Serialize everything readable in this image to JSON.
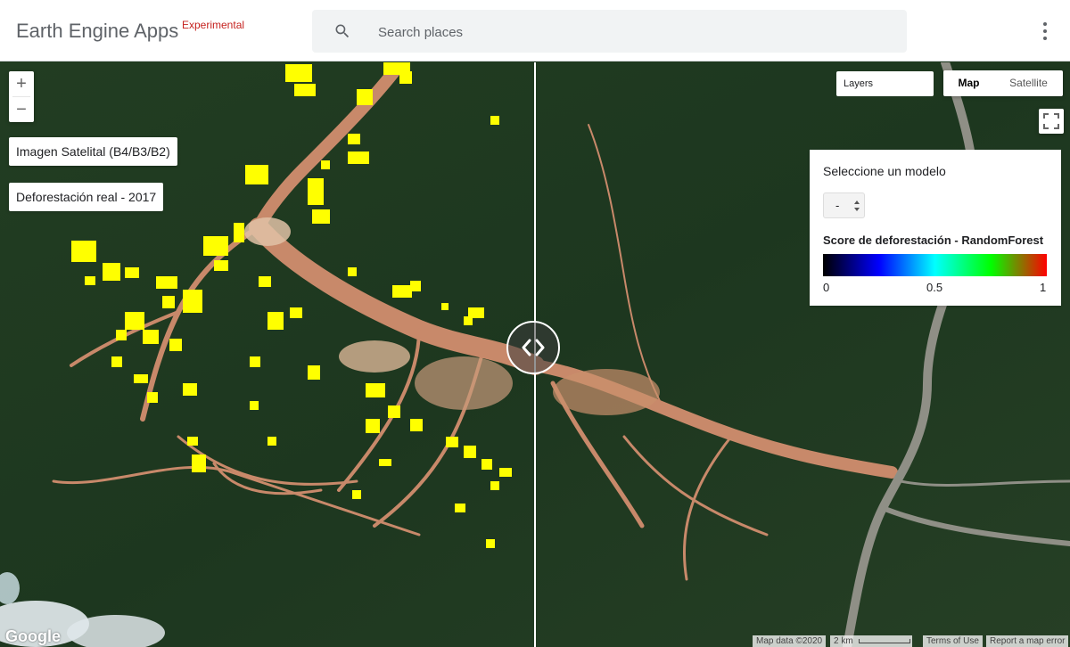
{
  "header": {
    "app_title": "Earth Engine Apps",
    "badge": "Experimental",
    "search_placeholder": "Search places",
    "search_value": "",
    "search_icon": "search-icon",
    "menu_icon": "more-vert-icon"
  },
  "map": {
    "zoom_in_label": "+",
    "zoom_out_label": "−",
    "layer_buttons": [
      "Imagen Satelital (B4/B3/B2)",
      "Deforestación real - 2017"
    ],
    "layers_dropdown": "Layers",
    "map_type": [
      "Map",
      "Satellite"
    ],
    "map_type_selected": "Map",
    "fullscreen_icon": "fullscreen-icon",
    "swipe_icon": "chevron-left-right-icon",
    "colors": {
      "deforestation": "#ffff00",
      "river": "#c8896a",
      "forest": "#1f3a1e"
    }
  },
  "panel": {
    "title": "Seleccione un modelo",
    "model_value": "-",
    "legend_title": "Score de deforestación - RandomForest",
    "legend_min": "0",
    "legend_mid": "0.5",
    "legend_max": "1",
    "legend_colors": [
      "#000000",
      "#0000ff",
      "#00ffff",
      "#00ff00",
      "#ff0000"
    ]
  },
  "footer": {
    "logo": "Google",
    "map_data": "Map data ©2020",
    "scale": "2 km",
    "terms": "Terms of Use",
    "report": "Report a map error"
  }
}
